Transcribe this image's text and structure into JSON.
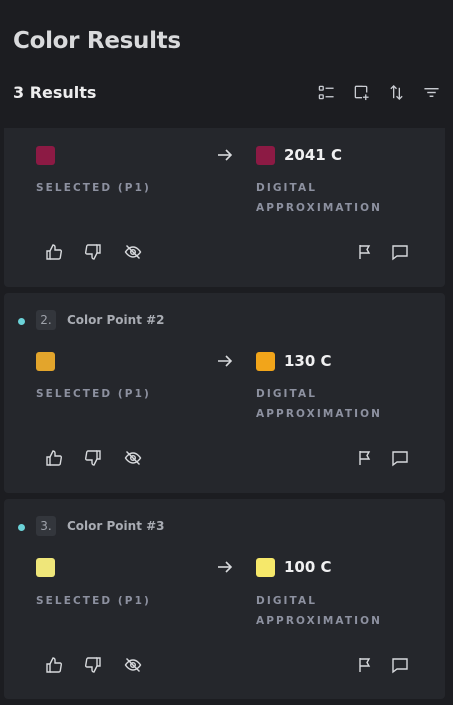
{
  "header": {
    "title": "Color Results",
    "results_count": "3 Results",
    "tools": [
      "list-view-icon",
      "add-frame-icon",
      "sort-icon",
      "filter-icon"
    ]
  },
  "labels": {
    "selected": "SELECTED (P1)",
    "digital_1": "DIGITAL",
    "digital_2": "APPROXIMATION"
  },
  "cards": [
    {
      "selected_color": "#8c1a44",
      "approx_color": "#8c1a44",
      "approx_code": "2041 C"
    },
    {
      "number": "2.",
      "name": "Color Point #2",
      "selected_color": "#e3a52c",
      "approx_color": "#f2a51a",
      "approx_code": "130 C"
    },
    {
      "number": "3.",
      "name": "Color Point #3",
      "selected_color": "#efe67a",
      "approx_color": "#f6e86a",
      "approx_code": "100 C"
    }
  ],
  "colors": {
    "accent_dot": "#6bd2d8",
    "background": "#1c1d21",
    "card": "#25272c"
  }
}
